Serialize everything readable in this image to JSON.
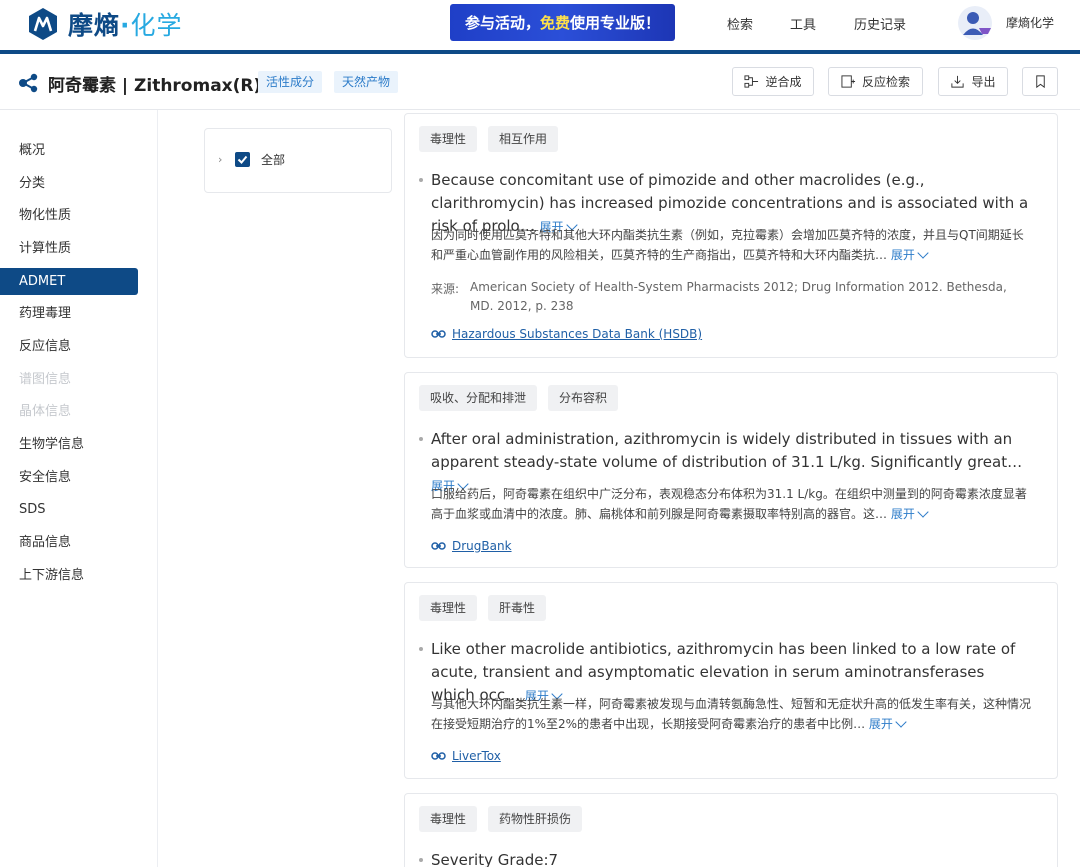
{
  "header": {
    "logo_main": "摩熵",
    "logo_dot": "·",
    "logo_sub": "化学",
    "promo": {
      "pre": "参与活动，",
      "highlight": "免费",
      "post": "使用专业版！"
    },
    "nav": [
      "检索",
      "工具",
      "历史记录"
    ],
    "user_name": "摩熵化学"
  },
  "titlebar": {
    "title": "阿奇霉素 | Zithromax(R)",
    "tags": [
      "活性成分",
      "天然产物"
    ],
    "buttons": {
      "retro": "逆合成",
      "reaction": "反应检索",
      "export": "导出"
    }
  },
  "sidebar": {
    "items": [
      {
        "label": "概况",
        "state": "normal"
      },
      {
        "label": "分类",
        "state": "normal"
      },
      {
        "label": "物化性质",
        "state": "normal"
      },
      {
        "label": "计算性质",
        "state": "normal"
      },
      {
        "label": "ADMET",
        "state": "active"
      },
      {
        "label": "药理毒理",
        "state": "normal"
      },
      {
        "label": "反应信息",
        "state": "normal"
      },
      {
        "label": "谱图信息",
        "state": "disabled"
      },
      {
        "label": "晶体信息",
        "state": "disabled"
      },
      {
        "label": "生物学信息",
        "state": "normal"
      },
      {
        "label": "安全信息",
        "state": "normal"
      },
      {
        "label": "SDS",
        "state": "normal"
      },
      {
        "label": "商品信息",
        "state": "normal"
      },
      {
        "label": "上下游信息",
        "state": "normal"
      }
    ]
  },
  "filter": {
    "label": "全部",
    "checked": true
  },
  "expand_label": "展开",
  "source_label": "来源:",
  "cards": [
    {
      "tags": [
        "毒理性",
        "相互作用"
      ],
      "en": "Because concomitant use of pimozide and other macrolides (e.g., clarithromycin) has increased pimozide concentrations and is associated with a risk of prolo…",
      "zh": "因为同时使用匹莫齐特和其他大环内酯类抗生素（例如，克拉霉素）会增加匹莫齐特的浓度，并且与QT间期延长和严重心血管副作用的风险相关，匹莫齐特的生产商指出，匹莫齐特和大环内酯类抗…",
      "source": "American Society of Health-System Pharmacists 2012; Drug Information 2012. Bethesda, MD. 2012, p. 238",
      "link": "Hazardous Substances Data Bank (HSDB)"
    },
    {
      "tags": [
        "吸收、分配和排泄",
        "分布容积"
      ],
      "en": "After oral administration, azithromycin is widely distributed in tissues with an apparent steady-state volume of distribution of 31.1 L/kg. Significantly great…",
      "zh": "口服给药后，阿奇霉素在组织中广泛分布，表观稳态分布体积为31.1 L/kg。在组织中测量到的阿奇霉素浓度显著高于血浆或血清中的浓度。肺、扁桃体和前列腺是阿奇霉素摄取率特别高的器官。这…",
      "link": "DrugBank"
    },
    {
      "tags": [
        "毒理性",
        "肝毒性"
      ],
      "en": "Like other macrolide antibiotics, azithromycin has been linked to a low rate of acute, transient and asymptomatic elevation in serum aminotransferases which occ…",
      "zh": "与其他大环内酯类抗生素一样，阿奇霉素被发现与血清转氨酶急性、短暂和无症状升高的低发生率有关，这种情况在接受短期治疗的1%至2%的患者中出现，长期接受阿奇霉素治疗的患者中比例…",
      "link": "LiverTox"
    },
    {
      "tags": [
        "毒理性",
        "药物性肝损伤"
      ],
      "en": "Severity Grade:7"
    }
  ]
}
